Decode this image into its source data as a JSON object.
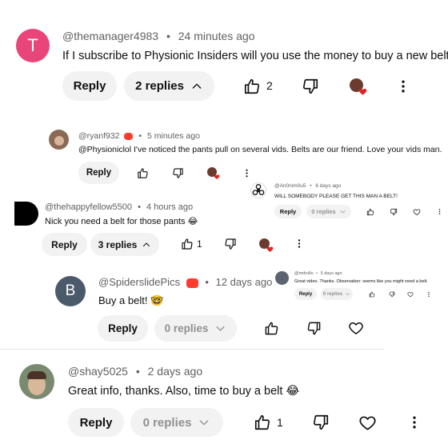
{
  "colors": {
    "accent_pink": "#e8467a",
    "reply_blue_avatar": "#4a5a6a",
    "heart_red": "#e02424",
    "pill_bg": "#f2f2f2"
  },
  "c1": {
    "initial": "T",
    "username": "@themanager4983",
    "time": "24 minutes ago",
    "text": "If I subscribe to Physionic Insiders will you use the money to buy a new belt?",
    "reply_label": "Reply",
    "replies_label": "2 replies",
    "likes": "2"
  },
  "c2": {
    "username": "@ryanf932",
    "time": "5 minutes ago",
    "text": "@Physioniclol I've noticed the pants pull on several vids.  Belts are our friend.  Love your vids man.",
    "reply_label": "Reply"
  },
  "c3": {
    "username": "@An0nim0u5",
    "time": "6 days ago",
    "text": "WILL SOMEBODY PLEASE GET THIS MAN A BELT!",
    "reply_label": "Reply",
    "replies_label": "0 replies"
  },
  "c4": {
    "username": "@thehappyfellow5500",
    "time": "4 hours ago",
    "text": "Nick you need a belt for those pants 😂",
    "reply_label": "Reply",
    "replies_label": "3 replies",
    "likes": "1"
  },
  "c5": {
    "initial": "B",
    "username": "@SpiderslidePics",
    "time": "12 days ago",
    "text": "Buy a belt! 🤓",
    "reply_label": "Reply",
    "replies_label": "0 replies"
  },
  "c6": {
    "username": "@mdrollo",
    "time": "5 days ago",
    "text": "Great video. Thanks. Observation: seems like you might need a belt.",
    "reply_label": "Reply",
    "replies_label": "0 replies"
  },
  "c7": {
    "username": "@shay5025",
    "time": "2 days ago",
    "text": "Great info, thanks. Also, time to buy a belt 😂",
    "reply_label": "Reply",
    "replies_label": "0 replies",
    "likes": "1"
  },
  "separator": "•"
}
